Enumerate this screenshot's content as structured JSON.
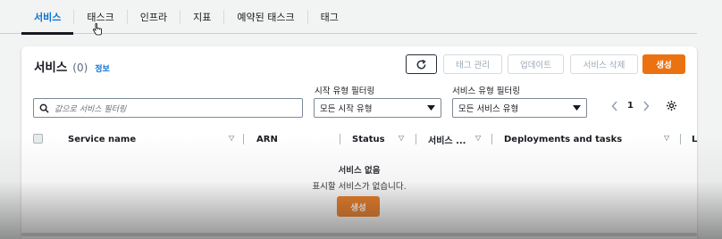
{
  "tabs": [
    "서비스",
    "태스크",
    "인프라",
    "지표",
    "예약된 태스크",
    "태그"
  ],
  "panel": {
    "title": "서비스",
    "count": "(0)",
    "info": "정보"
  },
  "actions": {
    "refresh_icon": "refresh-icon",
    "tag_manage": "태그 관리",
    "update": "업데이트",
    "delete": "서비스 삭제",
    "create": "생성"
  },
  "filters": {
    "search_placeholder": "값으로 서비스 필터링",
    "launch_type_label": "시작 유형 필터링",
    "launch_type_value": "모든 시작 유형",
    "service_type_label": "서비스 유형 필터링",
    "service_type_value": "모든 서비스 유형"
  },
  "pagination": {
    "page": "1"
  },
  "columns": [
    "Service name",
    "ARN",
    "Status",
    "서비스 ...",
    "Deployments and tasks",
    "L"
  ],
  "empty": {
    "title": "서비스 없음",
    "description": "표시할 서비스가 없습니다.",
    "button": "생성"
  },
  "colors": {
    "accent": "#0972d3",
    "primary_button": "#ec7211"
  }
}
